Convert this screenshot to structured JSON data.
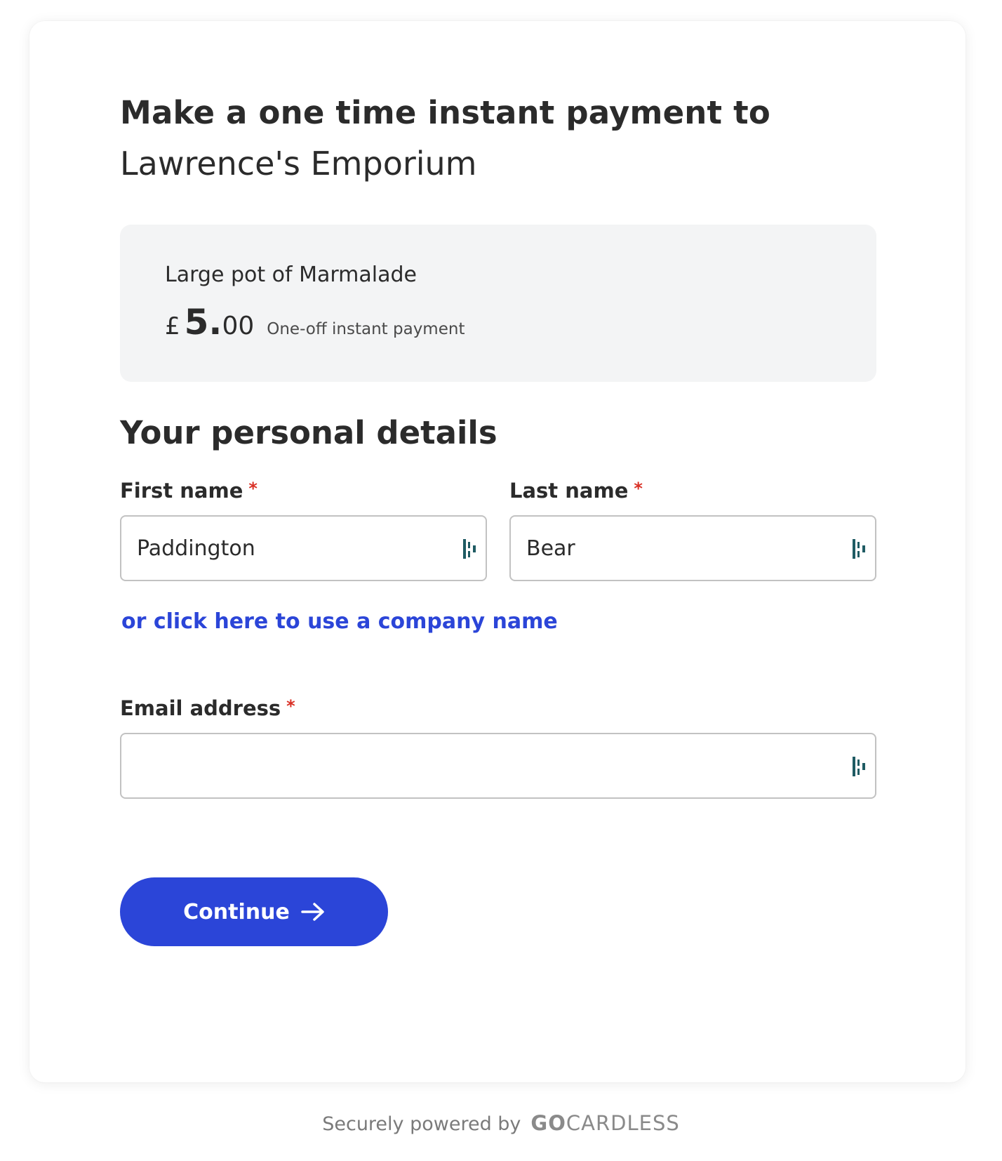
{
  "header": {
    "title": "Make a one time instant payment to",
    "merchant": "Lawrence's Emporium"
  },
  "summary": {
    "item": "Large pot of Marmalade",
    "currency_symbol": "£",
    "amount_major": "5.",
    "amount_minor": "00",
    "payment_type": "One-off instant payment"
  },
  "personal_details": {
    "title": "Your personal details",
    "required_marker": "*",
    "first_name": {
      "label": "First name",
      "value": "Paddington"
    },
    "last_name": {
      "label": "Last name",
      "value": "Bear"
    },
    "company_link": "or click here to use a company name",
    "email": {
      "label": "Email address",
      "value": ""
    }
  },
  "actions": {
    "continue_label": "Continue"
  },
  "footer": {
    "text": "Securely powered by",
    "brand_go": "GO",
    "brand_rest": "CARDLESS"
  },
  "icons": {
    "field_autofill": "dashlane-autofill-icon",
    "continue_arrow": "arrow-right-icon"
  },
  "colors": {
    "primary": "#2b45d8",
    "required": "#d93025",
    "summary_bg": "#f3f4f5",
    "autofill_icon": "#1f5b63"
  }
}
